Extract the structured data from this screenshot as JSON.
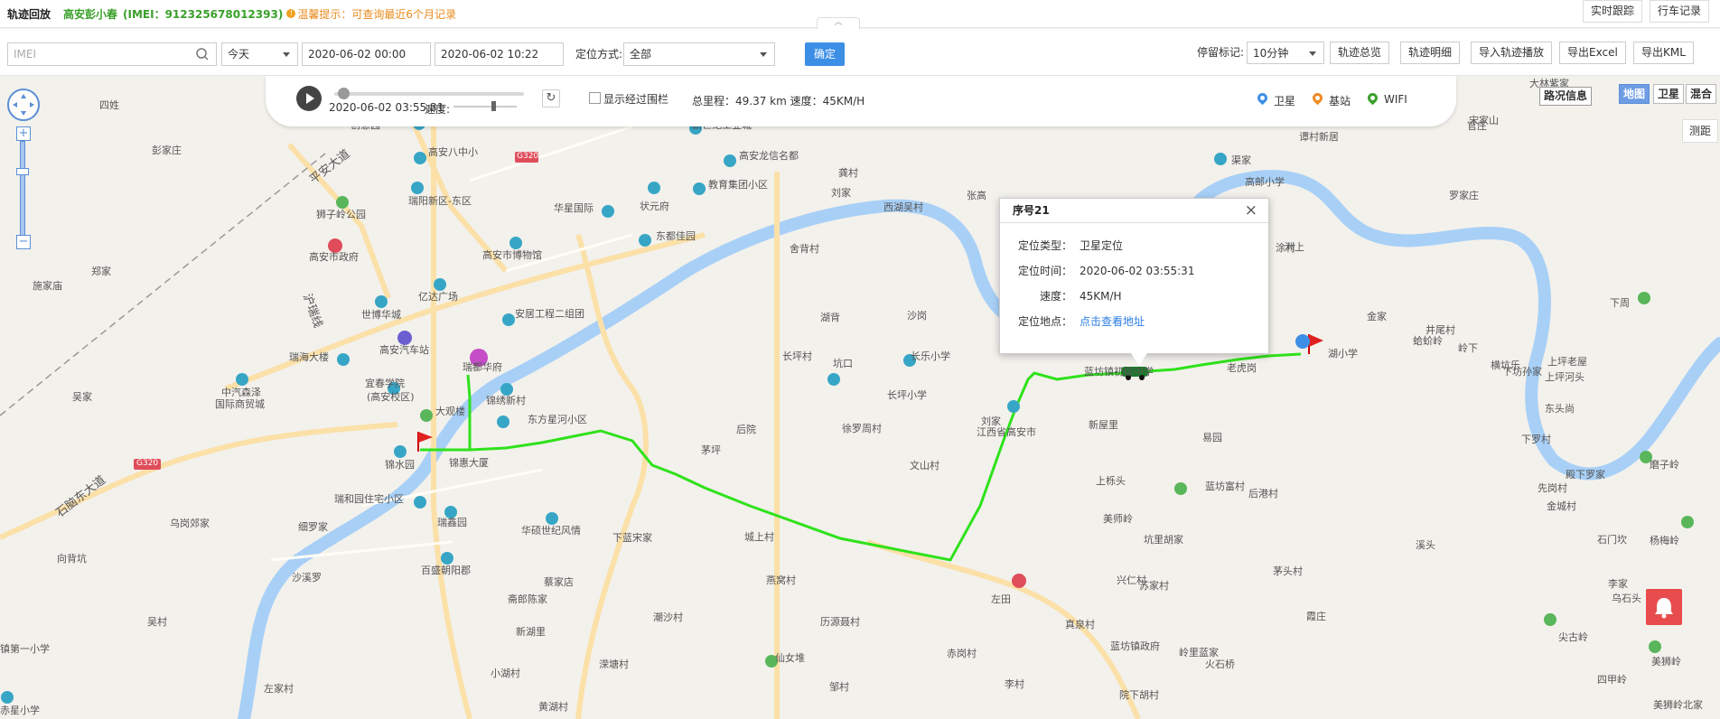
{
  "header": {
    "title": "轨迹回放",
    "device_name": "高安彭小春",
    "imei_text": "(IMEI：912325678012393)",
    "tip_icon": "!",
    "tip": "温馨提示：可查询最近6个月记录",
    "realtime_btn": "实时跟踪",
    "driving_record_btn": "行车记录",
    "collapse_glyph": "︿"
  },
  "toolbar": {
    "imei_placeholder": "IMEI",
    "range_select": "今天",
    "start_time": "2020-06-02 00:00",
    "end_time": "2020-06-02 10:22",
    "locate_mode_label": "定位方式:",
    "locate_mode_value": "全部",
    "confirm_btn": "确定",
    "stop_mark_label": "停留标记:",
    "stop_mark_value": "10分钟",
    "track_overview_btn": "轨迹总览",
    "track_detail_btn": "轨迹明细",
    "import_playback_btn": "导入轨迹播放",
    "export_excel_btn": "导出Excel",
    "export_kml_btn": "导出KML"
  },
  "playback": {
    "current_time": "2020-06-02 03:55:31",
    "speed_label": "速度:",
    "show_fence_label": "显示经过围栏",
    "summary": "总里程：49.37 km 速度：45KM/H",
    "progress": 0.05,
    "refresh_glyph": "↻",
    "legend": [
      {
        "label": "卫星",
        "color": "#3d8fe6"
      },
      {
        "label": "基站",
        "color": "#f08a24"
      },
      {
        "label": "WIFI",
        "color": "#3aa02a"
      }
    ]
  },
  "map_controls": {
    "map_types": [
      "地图",
      "卫星",
      "混合"
    ],
    "active_map_type": "地图",
    "traffic": "路况信息",
    "ranging": "测距",
    "zoom_in": "+",
    "zoom_out": "−"
  },
  "popup": {
    "title": "序号21",
    "close_glyph": "×",
    "rows": [
      {
        "label": "定位类型：",
        "value": "卫星定位"
      },
      {
        "label": "定位时间：",
        "value": "2020-06-02 03:55:31"
      },
      {
        "label": "速度：",
        "value": "45KM/H"
      },
      {
        "label": "定位地点：",
        "value": "点击查看地址"
      }
    ]
  },
  "map_labels": [
    "创意园",
    "嘉庭凤情",
    "新世纪工业城",
    "高安八中小",
    "G320",
    "高安龙信名都",
    "瑞阳新区-东区",
    "华星国际",
    "状元府",
    "教育集团小区",
    "东都佳园",
    "狮子岭公园",
    "高安市政府",
    "高安市博物馆",
    "亿达广场",
    "世博华城",
    "安居工程二组团",
    "高安汽车站",
    "瑞都华府",
    "宜春学院",
    "(高安校区)",
    "锦绣新村",
    "大观楼",
    "东方星河小区",
    "锦水园",
    "锦惠大厦",
    "瑞和园住宅小区",
    "瑞鑫园",
    "华硕世纪风情",
    "百盛朝阳郡",
    "中汽森泽",
    "国际商贸城",
    "瑞海大楼",
    "四姓",
    "彭家庄",
    "郑家",
    "施家庙",
    "吴家",
    "石脑东大道",
    "乌岗郊家",
    "细罗家",
    "向背坑",
    "沙溪罗",
    "吴村",
    "镇第一小学",
    "左家村",
    "赤星小学",
    "蔡家店",
    "斋郎陈家",
    "新湖里",
    "潮沙村",
    "溁塘村",
    "小湖村",
    "黄湖村",
    "下蓝宋家",
    "城上村",
    "燕窝村",
    "历源聂村",
    "仙女堆",
    "邹村",
    "赤岗村",
    "李村",
    "龚村",
    "刘家",
    "西湖吴村",
    "张高",
    "舍背村",
    "湖背",
    "沙岗",
    "长坪村",
    "长乐小学",
    "坑口",
    "长坪小学",
    "徐罗周村",
    "后院",
    "茅坪",
    "文山村",
    "刘家",
    "江西省高安市",
    "蓝坊镇初级中学",
    "新屋里",
    "蓝坊富村",
    "美师岭",
    "坑里胡家",
    "兴仁村",
    "苏家村",
    "左田",
    "蓝坊镇政府",
    "院下胡村",
    "火石桥",
    "真泉村",
    "岭里蓝家",
    "后港村",
    "上栎头",
    "易园",
    "老虎岗",
    "渠家",
    "高邮小学",
    "谭村新居",
    "罗家庄",
    "涂村",
    "中房",
    "洲上",
    "金家",
    "井尾村",
    "岭下",
    "蛤蚧岭",
    "横坑乐",
    "下周",
    "下坊孙家",
    "上坪老屋",
    "上坪河头",
    "东头尚",
    "下罗村",
    "殿下罗家",
    "先岗村",
    "金城村",
    "溪头",
    "石门坎",
    "茅头村",
    "霞庄",
    "尖古岭",
    "磨子岭",
    "杨梅岭",
    "李家",
    "乌石头",
    "美狮岭",
    "四甲岭",
    "美狮岭北家",
    "官庄",
    "宋家山",
    "大林紫家",
    "湖小学",
    "平安大道",
    "沪瑞线"
  ],
  "colors": {
    "track": "#2ee21a",
    "river": "#a8d0f7",
    "accent": "#3d8fe6",
    "sos": "#e84c4c"
  },
  "icons": [
    "play-icon",
    "refresh-icon",
    "search-icon",
    "close-icon",
    "bell-icon",
    "start-flag-icon",
    "end-flag-icon",
    "car-icon"
  ]
}
